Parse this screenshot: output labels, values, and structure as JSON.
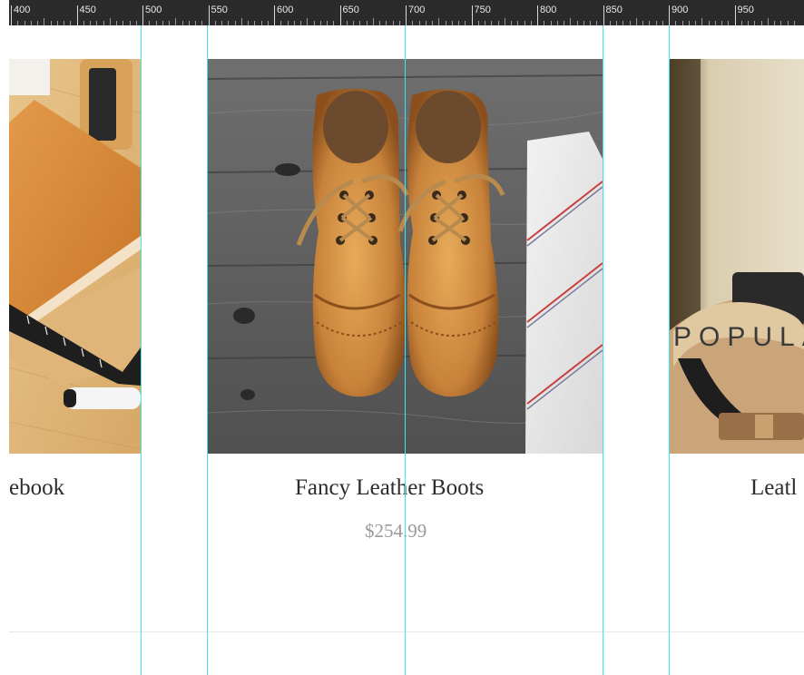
{
  "ruler": {
    "labels": [
      "400",
      "450",
      "500",
      "550",
      "600",
      "650",
      "700",
      "750",
      "800",
      "850",
      "900",
      "950"
    ]
  },
  "products": [
    {
      "title": "ebook",
      "image": "notebook-photo"
    },
    {
      "title": "Fancy Leather Boots",
      "price": "$254.99",
      "image": "leather-boots-photo"
    },
    {
      "title": "Leatl",
      "image": "leather-camera-strap-photo"
    }
  ],
  "overlay_text": "POPULA",
  "colors": {
    "guide": "#3ee6ea",
    "ruler_bg": "#2b2b2b",
    "title": "#2c2c2c",
    "price": "#9a9a9a"
  }
}
